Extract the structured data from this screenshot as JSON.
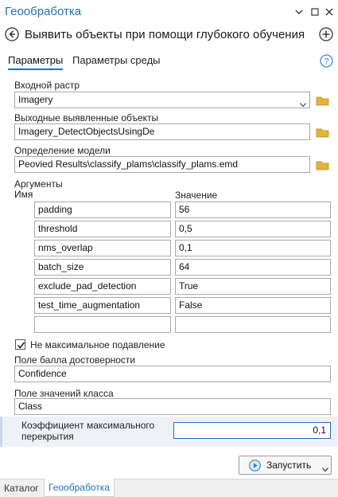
{
  "header": {
    "app_title": "Геообработка",
    "window_icons": [
      "chevron-down-icon",
      "restore-icon",
      "close-icon"
    ]
  },
  "tool": {
    "title": "Выявить объекты при помощи глубокого обучения"
  },
  "tabs": [
    {
      "label": "Параметры",
      "active": true
    },
    {
      "label": "Параметры среды",
      "active": false
    }
  ],
  "params": {
    "input_raster": {
      "label": "Входной растр",
      "value": "Imagery"
    },
    "output_objects": {
      "label": "Выходные выявленные объекты",
      "value": "Imagery_DetectObjectsUsingDe"
    },
    "model_definition": {
      "label": "Определение модели",
      "value": "Peovied Results\\classify_plams\\classify_plams.emd"
    },
    "arguments": {
      "label": "Аргументы",
      "col_name": "Имя",
      "col_value": "Значение",
      "rows": [
        {
          "name": "padding",
          "value": "56"
        },
        {
          "name": "threshold",
          "value": "0,5"
        },
        {
          "name": "nms_overlap",
          "value": "0,1"
        },
        {
          "name": "batch_size",
          "value": "64"
        },
        {
          "name": "exclude_pad_detection",
          "value": "True"
        },
        {
          "name": "test_time_augmentation",
          "value": "False"
        },
        {
          "name": "",
          "value": ""
        }
      ]
    },
    "nms_checkbox": {
      "label": "Не максимальное подавление",
      "checked": true
    },
    "confidence_field": {
      "label": "Поле балла достоверности",
      "value": "Confidence"
    },
    "class_field": {
      "label": "Поле значений класса",
      "value": "Class"
    },
    "max_overlap": {
      "label_line1": "Коэффициент максимального",
      "label_line2": "перекрытия",
      "value": "0,1"
    }
  },
  "footer": {
    "run_label": "Запустить"
  },
  "bottom_tabs": [
    {
      "label": "Каталог",
      "active": false
    },
    {
      "label": "Геообработка",
      "active": true
    }
  ],
  "colors": {
    "accent": "#1f6fc5",
    "title": "#2a6fb3",
    "folder": "#e1b43a"
  }
}
